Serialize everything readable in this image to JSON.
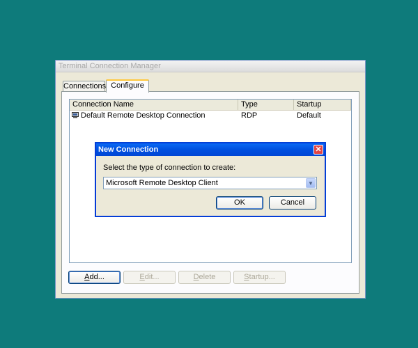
{
  "main_window": {
    "title": "Terminal Connection Manager",
    "tabs": [
      {
        "label": "Connections",
        "active": false
      },
      {
        "label": "Configure",
        "active": true
      }
    ],
    "list": {
      "columns": [
        "Connection Name",
        "Type",
        "Startup"
      ],
      "rows": [
        {
          "icon": "rdp-computer-icon",
          "name": "Default Remote Desktop Connection",
          "type": "RDP",
          "startup": "Default"
        }
      ]
    },
    "buttons": {
      "add": {
        "prefix": "",
        "mnemonic": "A",
        "rest": "dd...",
        "enabled": true
      },
      "edit": {
        "prefix": "",
        "mnemonic": "E",
        "rest": "dit...",
        "enabled": false
      },
      "delete": {
        "prefix": "",
        "mnemonic": "D",
        "rest": "elete",
        "enabled": false
      },
      "startup": {
        "prefix": "",
        "mnemonic": "S",
        "rest": "tartup...",
        "enabled": false
      }
    }
  },
  "dialog": {
    "title": "New Connection",
    "prompt": "Select the type of connection to create:",
    "connection_type": "Microsoft Remote Desktop Client",
    "ok_label": "OK",
    "cancel_label": "Cancel"
  },
  "colors": {
    "desktop": "#0e7b7b",
    "dialog_titlebar": "#0050e0",
    "close_button": "#e04343"
  }
}
